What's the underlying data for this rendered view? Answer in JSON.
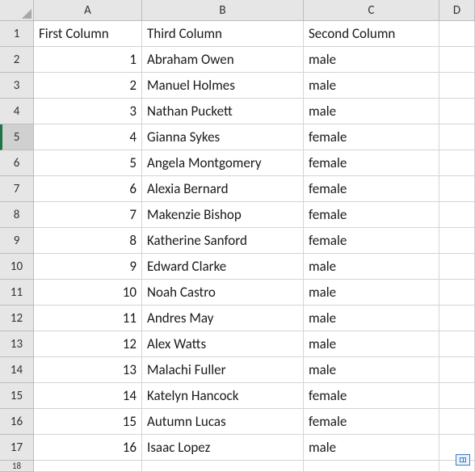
{
  "columns": [
    "A",
    "B",
    "C",
    "D"
  ],
  "headerRow": {
    "A": "First Column",
    "B": "Third Column",
    "C": "Second Column"
  },
  "selectedRow": 5,
  "rows": [
    {
      "n": 1,
      "A": "First Column",
      "B": "Third Column",
      "C": "Second Column"
    },
    {
      "n": 2,
      "A": "1",
      "B": "Abraham Owen",
      "C": "male"
    },
    {
      "n": 3,
      "A": "2",
      "B": "Manuel Holmes",
      "C": "male"
    },
    {
      "n": 4,
      "A": "3",
      "B": "Nathan Puckett",
      "C": "male"
    },
    {
      "n": 5,
      "A": "4",
      "B": "Gianna Sykes",
      "C": "female"
    },
    {
      "n": 6,
      "A": "5",
      "B": "Angela Montgomery",
      "C": "female"
    },
    {
      "n": 7,
      "A": "6",
      "B": "Alexia Bernard",
      "C": "female"
    },
    {
      "n": 8,
      "A": "7",
      "B": "Makenzie Bishop",
      "C": "female"
    },
    {
      "n": 9,
      "A": "8",
      "B": "Katherine Sanford",
      "C": "female"
    },
    {
      "n": 10,
      "A": "9",
      "B": "Edward Clarke",
      "C": "male"
    },
    {
      "n": 11,
      "A": "10",
      "B": "Noah Castro",
      "C": "male"
    },
    {
      "n": 12,
      "A": "11",
      "B": "Andres May",
      "C": "male"
    },
    {
      "n": 13,
      "A": "12",
      "B": "Alex Watts",
      "C": "male"
    },
    {
      "n": 14,
      "A": "13",
      "B": "Malachi Fuller",
      "C": "male"
    },
    {
      "n": 15,
      "A": "14",
      "B": "Katelyn Hancock",
      "C": "female"
    },
    {
      "n": 16,
      "A": "15",
      "B": "Autumn Lucas",
      "C": "female"
    },
    {
      "n": 17,
      "A": "16",
      "B": "Isaac Lopez",
      "C": "male"
    }
  ],
  "partialNextRow": 18
}
